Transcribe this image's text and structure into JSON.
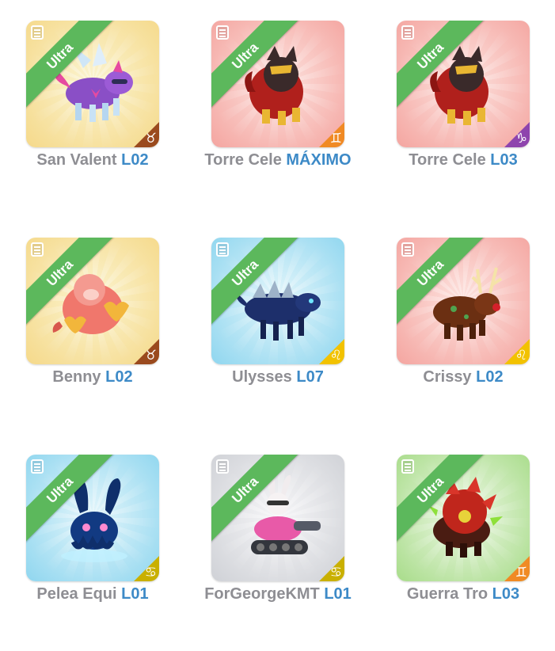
{
  "cards": [
    {
      "name": "San Valent",
      "level": "L02",
      "ribbon": "Ultra",
      "sign_icon": "taurus-icon",
      "sign_glyph": "♉",
      "sign_color": "#9a4a1e",
      "bg": "yellow"
    },
    {
      "name": "Torre Cele",
      "level": "MÁXIMO",
      "ribbon": "Ultra",
      "sign_icon": "gemini-icon",
      "sign_glyph": "♊",
      "sign_color": "#f08a24",
      "bg": "red"
    },
    {
      "name": "Torre Cele",
      "level": "L03",
      "ribbon": "Ultra",
      "sign_icon": "capricorn-icon",
      "sign_glyph": "♑",
      "sign_color": "#8e44ad",
      "bg": "red"
    },
    {
      "name": "Benny",
      "level": "L02",
      "ribbon": "Ultra",
      "sign_icon": "taurus-icon",
      "sign_glyph": "♉",
      "sign_color": "#9a4a1e",
      "bg": "yellow"
    },
    {
      "name": "Ulysses",
      "level": "L07",
      "ribbon": "Ultra",
      "sign_icon": "leo-icon",
      "sign_glyph": "♌",
      "sign_color": "#f2c200",
      "bg": "blue"
    },
    {
      "name": "Crissy",
      "level": "L02",
      "ribbon": "Ultra",
      "sign_icon": "leo-icon",
      "sign_glyph": "♌",
      "sign_color": "#f2c200",
      "bg": "red"
    },
    {
      "name": "Pelea Equi",
      "level": "L01",
      "ribbon": "Ultra",
      "sign_icon": "cancer-icon",
      "sign_glyph": "♋",
      "sign_color": "#c9b000",
      "bg": "blue"
    },
    {
      "name": "ForGeorgeKMT",
      "level": "L01",
      "ribbon": "Ultra",
      "sign_icon": "cancer-icon",
      "sign_glyph": "♋",
      "sign_color": "#c9b000",
      "bg": "gray"
    },
    {
      "name": "Guerra Tro",
      "level": "L03",
      "ribbon": "Ultra",
      "sign_icon": "gemini-icon",
      "sign_glyph": "♊",
      "sign_color": "#f08a24",
      "bg": "green"
    }
  ],
  "colors": {
    "ribbon": "#5cb85c",
    "level_text": "#3d8ac7",
    "name_text": "#8e8e93",
    "bg_yellow": [
      "#fbf4d0",
      "#f5d98a"
    ],
    "bg_red": [
      "#fde3df",
      "#f4a5a0"
    ],
    "bg_blue": [
      "#e4f6fb",
      "#8fd6ef"
    ],
    "bg_gray": [
      "#f6f6f8",
      "#cfd1d6"
    ],
    "bg_green": [
      "#eef8e6",
      "#a8dc8a"
    ]
  }
}
